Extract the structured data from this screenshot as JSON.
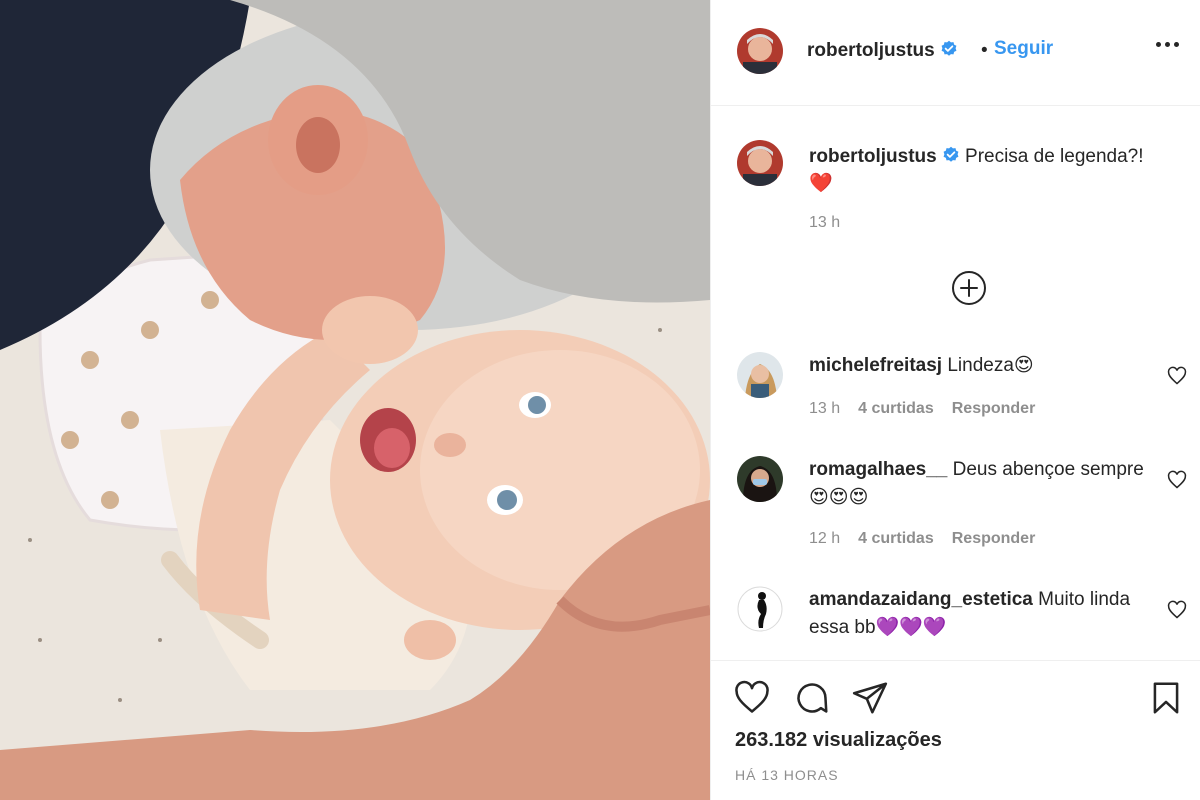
{
  "post": {
    "username": "robertoljustus",
    "follow_label": "Seguir",
    "separator": "•",
    "caption_text": "Precisa de legenda?!",
    "caption_emoji": "❤️",
    "caption_time": "13 h",
    "views": "263.182 visualizações",
    "posted_ago": "HÁ 13 HORAS"
  },
  "comments": [
    {
      "username": "michelefreitasj",
      "text": "Lindeza😍",
      "time": "13 h",
      "likes": "4 curtidas",
      "reply_label": "Responder"
    },
    {
      "username": "romagalhaes__",
      "text": "Deus abençoe sempre 😍😍😍",
      "time": "12 h",
      "likes": "4 curtidas",
      "reply_label": "Responder"
    },
    {
      "username": "amandazaidang_estetica",
      "text": "Muito linda essa bb💜💜💜"
    }
  ],
  "icons": {
    "verified": "verified-badge-icon",
    "more": "more-options-icon",
    "load_more": "plus-circle-icon",
    "like": "heart-icon",
    "comment": "comment-bubble-icon",
    "share": "paper-plane-icon",
    "save": "bookmark-icon"
  },
  "colors": {
    "link_blue": "#3897f0",
    "verified_blue": "#3897f0",
    "muted_text": "#8e8e8e",
    "text": "#262626",
    "border": "#efefef"
  }
}
